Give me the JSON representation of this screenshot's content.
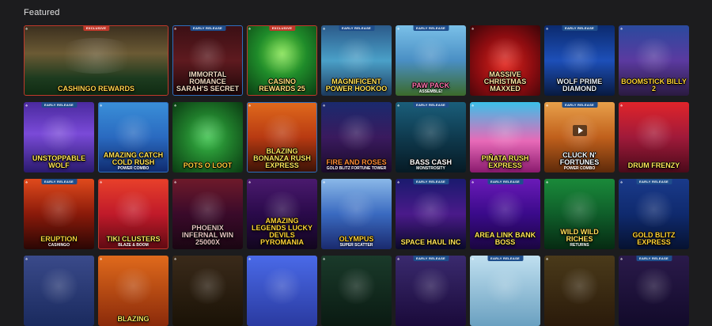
{
  "section": {
    "title": "Featured"
  },
  "tiles": [
    {
      "title": "CASHINGO REWARDS",
      "sub": "",
      "badge": "EXCLUSIVE",
      "badge_type": "exclusive",
      "wide": true,
      "border": "red",
      "bg": "linear-gradient(180deg,#3a2e1e 0%,#6b5a34 40%,#1d3b1f 75%,#0f2a12 100%)",
      "title_color": "#ffd54a",
      "icon": "award-icon"
    },
    {
      "title": "IMMORTAL ROMANCE SARAH'S SECRET",
      "sub": "",
      "badge": "EARLY RELEASE",
      "badge_type": "early",
      "wide": false,
      "border": "blue",
      "bg": "linear-gradient(180deg,#3a0f14 0%,#5e1a1f 50%,#1c0608 100%)",
      "title_color": "#f3d8c0",
      "icon": "heart-icon"
    },
    {
      "title": "CASINO REWARDS 25",
      "sub": "",
      "badge": "EXCLUSIVE",
      "badge_type": "exclusive",
      "wide": false,
      "border": "red",
      "bg": "radial-gradient(circle at 50% 40%,#7de04a 0%,#1f8b2a 45%,#0a3a12 100%)",
      "title_color": "#ffe27a",
      "icon": "star-icon"
    },
    {
      "title": "MAGNIFICENT POWER HOOKOO",
      "sub": "",
      "badge": "EARLY RELEASE",
      "badge_type": "early",
      "wide": false,
      "border": "none",
      "bg": "linear-gradient(180deg,#2b5a8a 0%,#4aa0c8 50%,#1d3b5e 100%)",
      "title_color": "#ffe35a",
      "icon": "owl-icon"
    },
    {
      "title": "PAW PACK",
      "sub": "ASSEMBLE!",
      "badge": "EARLY RELEASE",
      "badge_type": "early",
      "wide": false,
      "border": "none",
      "bg": "linear-gradient(180deg,#7ac0e8 0%,#4a8fc4 50%,#3b6a2a 100%)",
      "title_color": "#ff7ab0",
      "icon": "paw-icon"
    },
    {
      "title": "MASSIVE CHRISTMAS MAXXED",
      "sub": "",
      "badge": "",
      "badge_type": "",
      "wide": false,
      "border": "none",
      "bg": "radial-gradient(circle at 50% 55%,#e0241c 0%,#8a0c10 55%,#3a0508 100%)",
      "title_color": "#ffe0a0",
      "icon": "ornament-icon"
    },
    {
      "title": "WOLF PRIME DIAMOND",
      "sub": "",
      "badge": "EARLY RELEASE",
      "badge_type": "early",
      "wide": false,
      "border": "none",
      "bg": "linear-gradient(180deg,#0b2a6e 0%,#1d4fb8 50%,#081a40 100%)",
      "title_color": "#e6f0ff",
      "icon": "wolf-icon"
    },
    {
      "title": "BOOMSTICK BILLY 2",
      "sub": "",
      "badge": "",
      "badge_type": "",
      "wide": false,
      "border": "none",
      "bg": "linear-gradient(180deg,#2a4a9e 0%,#5b3aa0 50%,#2a1a40 100%)",
      "title_color": "#ffd23a",
      "icon": "dynamite-icon"
    },
    {
      "title": "UNSTOPPABLE WOLF",
      "sub": "",
      "badge": "EARLY RELEASE",
      "badge_type": "early",
      "wide": false,
      "border": "none",
      "bg": "linear-gradient(180deg,#4a2a9e 0%,#7a4ad8 45%,#2a1a6e 100%)",
      "title_color": "#ffe35a",
      "icon": "wolf-icon"
    },
    {
      "title": "AMAZING CATCH COLD RUSH",
      "sub": "POWER COMBO",
      "badge": "",
      "badge_type": "",
      "wide": false,
      "border": "blue",
      "bg": "linear-gradient(180deg,#3a8fd8 0%,#2a6ac0 50%,#0f2a6e 100%)",
      "title_color": "#ffe35a",
      "icon": "fish-icon"
    },
    {
      "title": "POTS O LOOT",
      "sub": "",
      "badge": "",
      "badge_type": "",
      "wide": false,
      "border": "none",
      "bg": "radial-gradient(circle at 50% 50%,#3ac04a 0%,#1f7a2a 50%,#0a3a12 100%)",
      "title_color": "#ffd23a",
      "icon": "pot-icon"
    },
    {
      "title": "BLAZING BONANZA RUSH EXPRESS",
      "sub": "",
      "badge": "",
      "badge_type": "",
      "wide": false,
      "border": "blue",
      "bg": "linear-gradient(180deg,#e06a1c 0%,#b83a12 50%,#3a1206 100%)",
      "title_color": "#ffe35a",
      "icon": "fire-icon"
    },
    {
      "title": "FIRE AND ROSES",
      "sub": "GOLD BLITZ FORTUNE TOWER",
      "badge": "",
      "badge_type": "",
      "wide": false,
      "border": "none",
      "bg": "linear-gradient(180deg,#1a2a6e 0%,#3a1a5e 50%,#1a0a2a 100%)",
      "title_color": "#ff8a3a",
      "icon": "rose-icon"
    },
    {
      "title": "BASS CASH",
      "sub": "MONSTROSITY",
      "badge": "EARLY RELEASE",
      "badge_type": "early",
      "wide": false,
      "border": "none",
      "bg": "linear-gradient(180deg,#1a5e7a 0%,#0f3a4e 50%,#061a24 100%)",
      "title_color": "#ffffff",
      "icon": "fish-icon"
    },
    {
      "title": "PIÑATA RUSH EXPRESS",
      "sub": "",
      "badge": "",
      "badge_type": "",
      "wide": false,
      "border": "none",
      "bg": "linear-gradient(180deg,#3ac0e8 0%,#e86ab8 55%,#8a1a6e 100%)",
      "title_color": "#ffe35a",
      "icon": "pinata-icon"
    },
    {
      "title": "CLUCK N' FORTUNES",
      "sub": "POWER COMBO",
      "badge": "EARLY RELEASE",
      "badge_type": "early",
      "wide": false,
      "border": "none",
      "bg": "linear-gradient(180deg,#e8a04a 0%,#c0601c 50%,#5e2a0a 100%)",
      "title_color": "#ffffff",
      "icon": "chicken-icon",
      "play": true
    },
    {
      "title": "DRUM FRENZY",
      "sub": "",
      "badge": "",
      "badge_type": "",
      "wide": false,
      "border": "none",
      "bg": "linear-gradient(180deg,#e0242a 0%,#a01a3a 50%,#4a0a1a 100%)",
      "title_color": "#ffe35a",
      "icon": "drum-icon"
    },
    {
      "title": "ERUPTION",
      "sub": "CASHINGO",
      "badge": "EARLY RELEASE",
      "badge_type": "early",
      "wide": false,
      "border": "none",
      "bg": "linear-gradient(180deg,#e04a1c 0%,#8a1a0a 50%,#2a0604 100%)",
      "title_color": "#ffd23a",
      "icon": "volcano-icon"
    },
    {
      "title": "TIKI CLUSTERS",
      "sub": "BLAZE & BOOM",
      "badge": "",
      "badge_type": "",
      "wide": false,
      "border": "red",
      "bg": "linear-gradient(180deg,#e8402a 0%,#c01a2a 50%,#5e0a12 100%)",
      "title_color": "#ffe35a",
      "icon": "tiki-icon"
    },
    {
      "title": "PHOENIX INFERNAL WIN 25000X",
      "sub": "",
      "badge": "",
      "badge_type": "",
      "wide": false,
      "border": "none",
      "bg": "linear-gradient(180deg,#6e1a2a 0%,#3a0a2a 50%,#1a0612 100%)",
      "title_color": "#e6c0c0",
      "icon": "phoenix-icon"
    },
    {
      "title": "AMAZING LEGENDS LUCKY DEVILS PYROMANIA",
      "sub": "",
      "badge": "",
      "badge_type": "",
      "wide": false,
      "border": "none",
      "bg": "linear-gradient(180deg,#4a1a6e 0%,#2a0a4a 50%,#12061e 100%)",
      "title_color": "#ffd23a",
      "icon": "devil-icon"
    },
    {
      "title": "OLYMPUS",
      "sub": "SUPER SCATTER",
      "badge": "",
      "badge_type": "",
      "wide": false,
      "border": "none",
      "bg": "linear-gradient(180deg,#8ab8e8 0%,#3a6ac0 50%,#1a2a6e 100%)",
      "title_color": "#ffd23a",
      "icon": "lightning-icon"
    },
    {
      "title": "SPACE HAUL INC",
      "sub": "",
      "badge": "EARLY RELEASE",
      "badge_type": "early",
      "wide": false,
      "border": "none",
      "bg": "linear-gradient(180deg,#1a1a6e 0%,#4a1a8a 50%,#0a0a2a 100%)",
      "title_color": "#ffe35a",
      "icon": "rocket-icon"
    },
    {
      "title": "AREA LINK BANK BOSS",
      "sub": "",
      "badge": "EARLY RELEASE",
      "badge_type": "early",
      "wide": false,
      "border": "none",
      "bg": "linear-gradient(180deg,#6a1ab8 0%,#3a0a8a 50%,#1a0640 100%)",
      "title_color": "#ffe35a",
      "icon": "pig-icon"
    },
    {
      "title": "WILD WILD RICHES",
      "sub": "RETURNS",
      "badge": "",
      "badge_type": "",
      "wide": false,
      "border": "none",
      "bg": "linear-gradient(180deg,#1a8a3a 0%,#0f5e2a 50%,#062a12 100%)",
      "title_color": "#ffe35a",
      "icon": "coin-icon"
    },
    {
      "title": "GOLD BLITZ EXPRESS",
      "sub": "",
      "badge": "EARLY RELEASE",
      "badge_type": "early",
      "wide": false,
      "border": "none",
      "bg": "linear-gradient(180deg,#1a3a8a 0%,#0f2a6e 50%,#061230 100%)",
      "title_color": "#ffd23a",
      "icon": "lightning-icon"
    },
    {
      "title": "",
      "sub": "",
      "badge": "",
      "badge_type": "",
      "wide": false,
      "border": "none",
      "bg": "linear-gradient(180deg,#3a4a8a 0%,#1a2a5e 100%)",
      "title_color": "#fff",
      "icon": ""
    },
    {
      "title": "BLAZING",
      "sub": "",
      "badge": "",
      "badge_type": "",
      "wide": false,
      "border": "none",
      "bg": "linear-gradient(180deg,#e06a1c 0%,#8a2a0a 100%)",
      "title_color": "#ffe35a",
      "icon": ""
    },
    {
      "title": "",
      "sub": "",
      "badge": "",
      "badge_type": "",
      "wide": false,
      "border": "none",
      "bg": "linear-gradient(180deg,#3a2a1a 0%,#1a1206 100%)",
      "title_color": "#fff",
      "icon": ""
    },
    {
      "title": "",
      "sub": "",
      "badge": "",
      "badge_type": "",
      "wide": false,
      "border": "none",
      "bg": "linear-gradient(180deg,#4a6ae8 0%,#2a3aa0 100%)",
      "title_color": "#fff",
      "icon": ""
    },
    {
      "title": "",
      "sub": "",
      "badge": "",
      "badge_type": "",
      "wide": false,
      "border": "none",
      "bg": "linear-gradient(180deg,#1a3a2a 0%,#0a1a12 100%)",
      "title_color": "#fff",
      "icon": ""
    },
    {
      "title": "",
      "sub": "",
      "badge": "EARLY RELEASE",
      "badge_type": "early",
      "wide": false,
      "border": "none",
      "bg": "linear-gradient(180deg,#3a2a6e 0%,#1a0a3a 100%)",
      "title_color": "#fff",
      "icon": ""
    },
    {
      "title": "",
      "sub": "",
      "badge": "EARLY RELEASE",
      "badge_type": "early",
      "wide": false,
      "border": "none",
      "bg": "linear-gradient(180deg,#c0e0f0 0%,#6aa0c0 100%)",
      "title_color": "#fff",
      "icon": ""
    },
    {
      "title": "",
      "sub": "",
      "badge": "",
      "badge_type": "",
      "wide": false,
      "border": "none",
      "bg": "linear-gradient(180deg,#4a3a1a 0%,#2a1a0a 100%)",
      "title_color": "#fff",
      "icon": ""
    },
    {
      "title": "",
      "sub": "",
      "badge": "EARLY RELEASE",
      "badge_type": "early",
      "wide": false,
      "border": "none",
      "bg": "linear-gradient(180deg,#2a1a4a 0%,#120a2a 100%)",
      "title_color": "#fff",
      "icon": ""
    }
  ]
}
